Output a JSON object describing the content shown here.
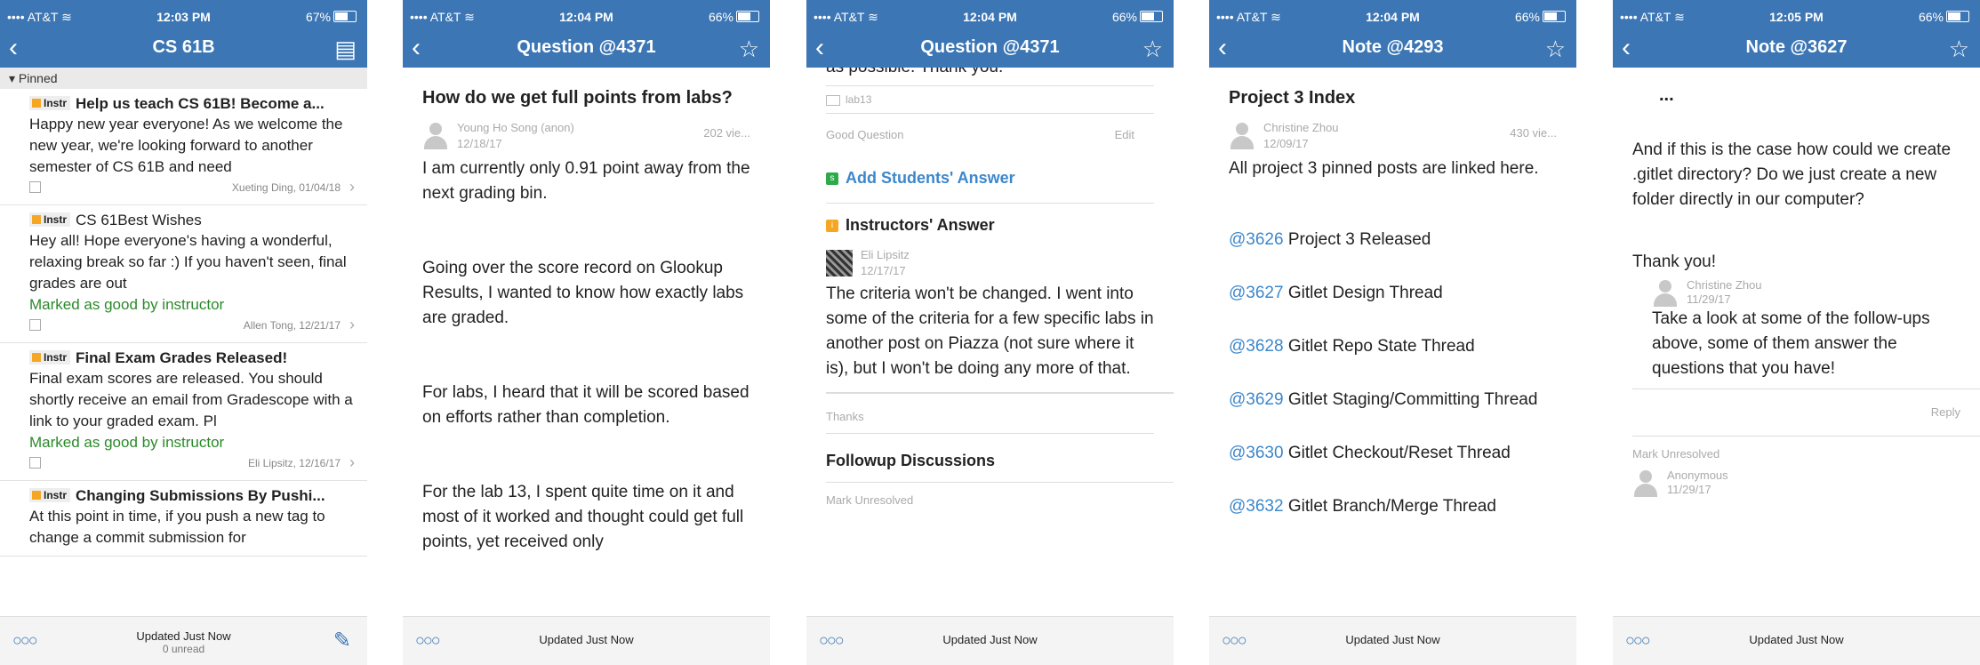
{
  "status": {
    "carrier": "AT&T",
    "times": [
      "12:03 PM",
      "12:04 PM",
      "12:04 PM",
      "12:04 PM",
      "12:05 PM"
    ],
    "battery": [
      "67%",
      "66%",
      "66%",
      "66%",
      "66%"
    ]
  },
  "panel1": {
    "title": "CS 61B",
    "pinned_label": "Pinned",
    "posts": [
      {
        "badge": "Instr",
        "title": "Help us teach CS 61B! Become a...",
        "body": " Happy new year everyone!   As we welcome the new year, we're looking forward to another semester of CS 61B and need",
        "good": "",
        "byline": "Xueting Ding, 01/04/18"
      },
      {
        "badge": "Instr",
        "title": "CS 61Best Wishes",
        "body": "Hey all! Hope everyone's having a wonderful, relaxing break so far :) If you haven't seen, final grades are out",
        "good": "Marked as good by instructor",
        "byline": "Allen Tong, 12/21/17"
      },
      {
        "badge": "Instr",
        "title": "Final Exam Grades Released!",
        "body": "Final exam scores are released. You should shortly receive an email from Gradescope with a link to your graded exam. Pl",
        "good": "Marked as good by instructor",
        "byline": "Eli Lipsitz, 12/16/17"
      },
      {
        "badge": "Instr",
        "title": "Changing Submissions By Pushi...",
        "body": "At this point in time, if you push a new tag to change a commit submission for",
        "good": "",
        "byline": ""
      }
    ],
    "bottom": {
      "updated": "Updated Just Now",
      "unread": "0 unread"
    }
  },
  "panel2": {
    "title": "Question @4371",
    "question": "How do we get full points from labs?",
    "author": "Young Ho Song (anon)",
    "date": "12/18/17",
    "views": "202 vie...",
    "paragraphs": [
      "I am currently only 0.91 point away from the next grading bin.",
      "Going over the score record on Glookup Results, I wanted to know how exactly labs are graded.",
      "For labs, I heard that it will be scored based on efforts rather than completion.",
      "For the lab 13, I spent quite time on it and most of it worked and thought could get full points, yet received only"
    ],
    "bottom": {
      "updated": "Updated Just Now"
    }
  },
  "panel3": {
    "title": "Question @4371",
    "cut_text": "as possible. Thank you.",
    "folder": "lab13",
    "good_question": "Good Question",
    "edit": "Edit",
    "add_students": "Add Students' Answer",
    "instructors_answer": "Instructors' Answer",
    "answer_author": "Eli Lipsitz",
    "answer_date": "12/17/17",
    "answer_text": "The criteria won't be changed. I went into some of the criteria for a few specific labs in another post on Piazza (not sure where it is), but I won't be doing any more of that.",
    "thanks": "Thanks",
    "followup": "Followup Discussions",
    "mark_unresolved": "Mark Unresolved",
    "bottom": {
      "updated": "Updated Just Now"
    }
  },
  "panel4": {
    "title": "Note @4293",
    "heading": "Project 3 Index",
    "author": "Christine Zhou",
    "date": "12/09/17",
    "views": "430 vie...",
    "intro": "All project 3 pinned posts are linked here.",
    "links": [
      {
        "ref": "@3626",
        "text": " Project 3 Released"
      },
      {
        "ref": "@3627",
        "text": " Gitlet Design Thread"
      },
      {
        "ref": "@3628",
        "text": " Gitlet Repo State Thread"
      },
      {
        "ref": "@3629",
        "text": " Gitlet Staging/Committing Thread"
      },
      {
        "ref": "@3630",
        "text": " Gitlet Checkout/Reset Thread"
      },
      {
        "ref": "@3632",
        "text": " Gitlet Branch/Merge Thread"
      }
    ],
    "bottom": {
      "updated": "Updated Just Now"
    }
  },
  "panel5": {
    "title": "Note @3627",
    "ellipsis": "...",
    "question_text": " And if this is the case how could we create .gitlet directory? Do we just create a new folder directly in our computer?",
    "thanks": "Thank you!",
    "reply_author": "Christine Zhou",
    "reply_date": "11/29/17",
    "reply_text": "Take a look at some of the follow-ups above, some of them answer the questions that you have!",
    "reply_button": "Reply",
    "mark_unresolved": "Mark Unresolved",
    "anon_author": "Anonymous",
    "anon_date": "11/29/17",
    "bottom": {
      "updated": "Updated Just Now"
    }
  }
}
